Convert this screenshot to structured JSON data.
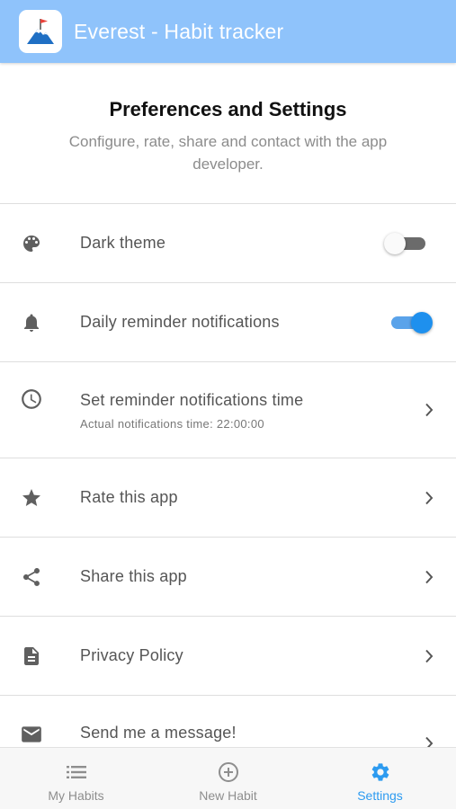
{
  "header": {
    "title": "Everest - Habit tracker",
    "logo_icon": "mountain-flag-logo",
    "background": "#8fc3fb"
  },
  "intro": {
    "title": "Preferences and Settings",
    "subtitle": "Configure, rate, share and contact with the app developer."
  },
  "settings": {
    "dark_theme": {
      "label": "Dark theme",
      "icon": "palette-icon",
      "enabled": false
    },
    "daily_reminder": {
      "label": "Daily reminder notifications",
      "icon": "bell-icon",
      "enabled": true
    },
    "reminder_time": {
      "label": "Set reminder notifications time",
      "sublabel": "Actual notifications time: 22:00:00",
      "icon": "clock-icon"
    },
    "rate": {
      "label": "Rate this app",
      "icon": "star-icon"
    },
    "share": {
      "label": "Share this app",
      "icon": "share-icon"
    },
    "privacy": {
      "label": "Privacy Policy",
      "icon": "document-icon"
    },
    "message": {
      "label": "Send me a message!",
      "icon": "mail-icon"
    }
  },
  "tabbar": {
    "tabs": [
      {
        "label": "My Habits",
        "icon": "list-icon",
        "active": false
      },
      {
        "label": "New Habit",
        "icon": "add-circle-icon",
        "active": false
      },
      {
        "label": "Settings",
        "icon": "gear-icon",
        "active": true
      }
    ],
    "active_color": "#2d9bf0"
  }
}
